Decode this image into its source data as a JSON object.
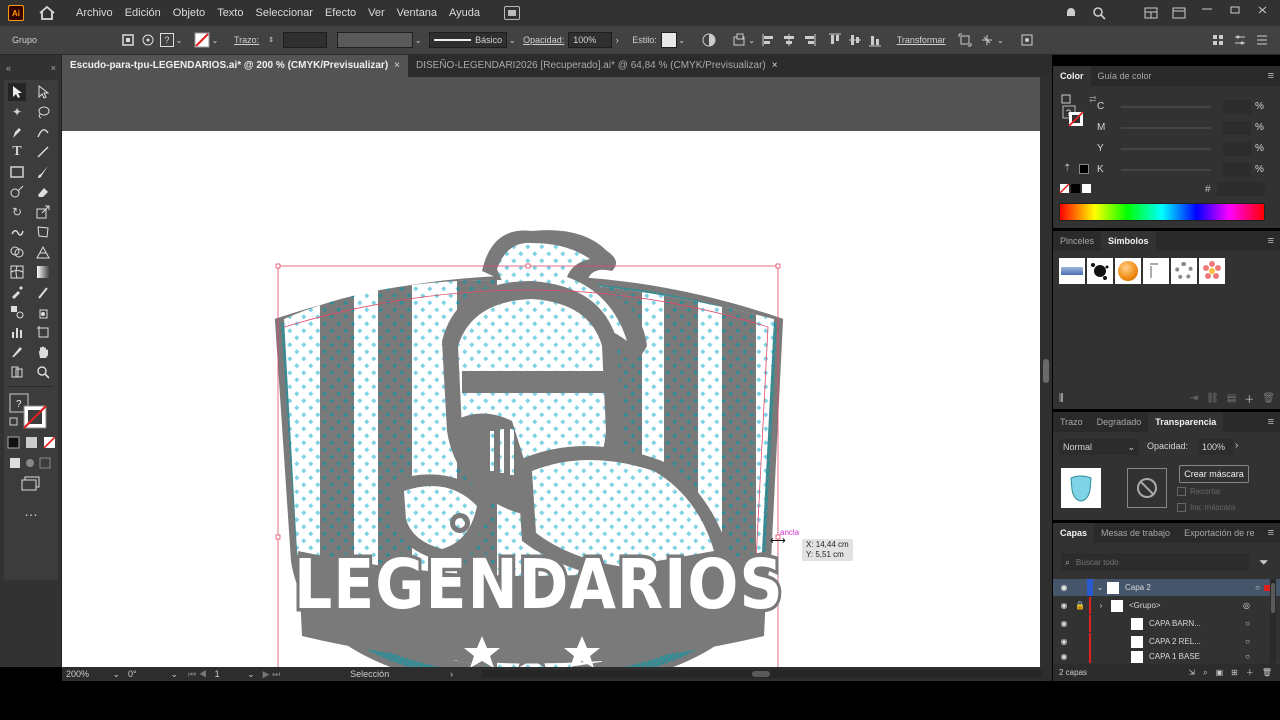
{
  "menubar": {
    "app_logo": "Ai",
    "items": [
      "Archivo",
      "Edición",
      "Objeto",
      "Texto",
      "Seleccionar",
      "Efecto",
      "Ver",
      "Ventana",
      "Ayuda"
    ],
    "icons": [
      "home-icon",
      "arrange-documents-icon",
      "notification-icon",
      "search-icon",
      "workspace-icon",
      "minimize-icon",
      "restore-icon",
      "close-icon"
    ]
  },
  "control_bar": {
    "selection_type": "Grupo",
    "stroke_label": "Trazo:",
    "brush_label": "Básico",
    "opacity_label": "Opacidad:",
    "opacity_value": "100%",
    "style_label": "Estilo:",
    "transform_label": "Transformar"
  },
  "tabs": [
    {
      "label": "Escudo-para-tpu-LEGENDARIOS.ai* @ 200 % (CMYK/Previsualizar)",
      "active": true
    },
    {
      "label": "DISEÑO-LEGENDARI2026 [Recuperado].ai* @ 64,84 % (CMYK/Previsualizar)",
      "active": false
    }
  ],
  "close_glyph": "×",
  "artwork": {
    "logo_text": "LEGENDARIOS",
    "anchor_label": "ancla",
    "measure_x": "X: 14,44 cm",
    "measure_y": "Y: 5,51 cm",
    "colors": {
      "shield_gray": "#7a7a7a",
      "pattern_blue": "#7fd3e6",
      "teal": "#2e8d97",
      "selection": "#e04a6a"
    }
  },
  "status_bar": {
    "zoom": "200%",
    "rotation": "0°",
    "artboard": "1",
    "tool": "Selección"
  },
  "color_panel": {
    "tabs": [
      "Color",
      "Guía de color"
    ],
    "channels": [
      {
        "label": "C",
        "unit": "%"
      },
      {
        "label": "M",
        "unit": "%"
      },
      {
        "label": "Y",
        "unit": "%"
      },
      {
        "label": "K",
        "unit": "%"
      }
    ],
    "hex_label": "#",
    "question": "?"
  },
  "brushes_panel": {
    "tabs": [
      "Pinceles",
      "Símbolos"
    ],
    "symbols": [
      "symbol-blue-bar",
      "symbol-splatter",
      "symbol-orange-ball",
      "symbol-ink",
      "symbol-ring",
      "symbol-flower"
    ]
  },
  "transparency_panel": {
    "tabs": [
      "Trazo",
      "Degradado",
      "Transparencia"
    ],
    "blend_mode": "Normal",
    "opacity_label": "Opacidad:",
    "opacity_value": "100%",
    "make_mask": "Crear máscara",
    "clip": "Recortar",
    "invert_mask": "Inv. máscara"
  },
  "layers_panel": {
    "tabs": [
      "Capas",
      "Mesas de trabajo",
      "Exportación de recu"
    ],
    "search_placeholder": "Buscar todo",
    "rows": [
      {
        "name": "Capa 2",
        "level": 0
      },
      {
        "name": "<Grupo>",
        "level": 1
      },
      {
        "name": "CAPA BARN...",
        "level": 2
      },
      {
        "name": "CAPA 2 REL...",
        "level": 2
      },
      {
        "name": "CAPA 1 BASE",
        "level": 2
      }
    ],
    "count": "2 capas"
  }
}
